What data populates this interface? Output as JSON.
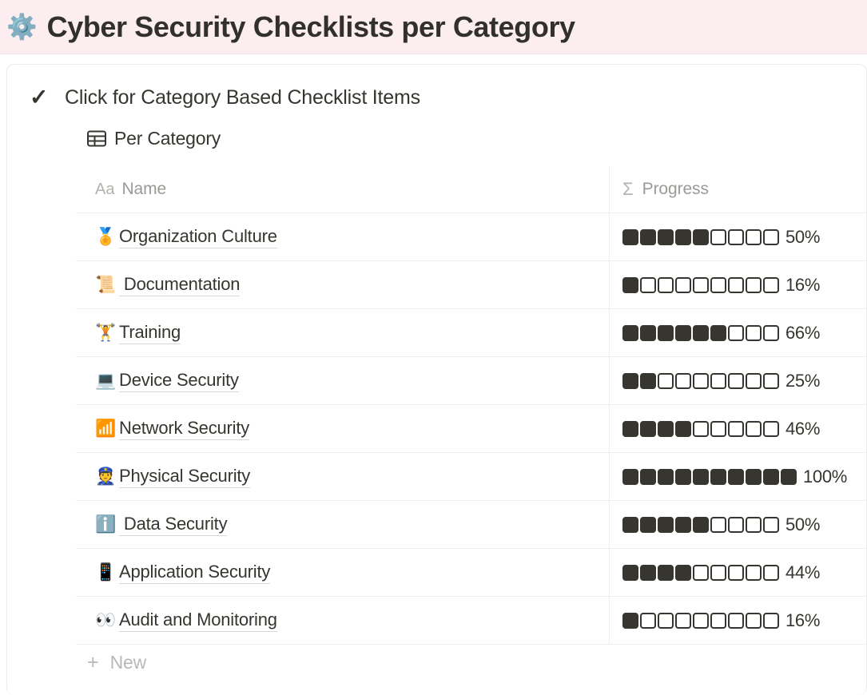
{
  "banner": {
    "emoji": "⚙️",
    "emoji_name": "gear-emoji",
    "title": "Cyber Security Checklists per Category",
    "background_color": "#fceef0"
  },
  "toggle": {
    "icon": "✓",
    "icon_name": "checkmark-icon",
    "label": "Click for Category Based Checklist Items"
  },
  "database": {
    "icon_name": "table-grid-icon",
    "title": "Per Category",
    "columns": [
      {
        "type_icon": "Aa",
        "label": "Name"
      },
      {
        "type_icon": "Σ",
        "label": "Progress"
      }
    ],
    "total_blocks_default": 9,
    "rows": [
      {
        "emoji": "🏅",
        "emoji_name": "medal-emoji",
        "name": "Organization Culture",
        "filled": 5,
        "total": 9,
        "percent": "50%"
      },
      {
        "emoji": "📜",
        "emoji_name": "scroll-emoji",
        "name": " Documentation",
        "filled": 1,
        "total": 9,
        "percent": "16%"
      },
      {
        "emoji": "🏋️",
        "emoji_name": "weightlifter-emoji",
        "name": "Training",
        "filled": 6,
        "total": 9,
        "percent": "66%"
      },
      {
        "emoji": "💻",
        "emoji_name": "laptop-emoji",
        "name": "Device Security",
        "filled": 2,
        "total": 9,
        "percent": "25%"
      },
      {
        "emoji": "📶",
        "emoji_name": "signal-bars-emoji",
        "name": "Network Security",
        "filled": 4,
        "total": 9,
        "percent": "46%"
      },
      {
        "emoji": "👮",
        "emoji_name": "police-officer-emoji",
        "name": "Physical Security",
        "filled": 10,
        "total": 10,
        "percent": "100%"
      },
      {
        "emoji": "ℹ️",
        "emoji_name": "information-emoji",
        "name": " Data Security",
        "filled": 5,
        "total": 9,
        "percent": "50%"
      },
      {
        "emoji": "📱",
        "emoji_name": "mobile-phone-emoji",
        "name": "Application Security",
        "filled": 4,
        "total": 9,
        "percent": "44%"
      },
      {
        "emoji": "👀",
        "emoji_name": "eyes-emoji",
        "name": "Audit and Monitoring",
        "filled": 1,
        "total": 9,
        "percent": "16%"
      }
    ],
    "new_row": {
      "icon": "+",
      "label": "New"
    }
  },
  "colors": {
    "text": "#37352f",
    "muted": "#9b9a97",
    "divider": "#eeeeed",
    "block_fill": "#37352f"
  }
}
